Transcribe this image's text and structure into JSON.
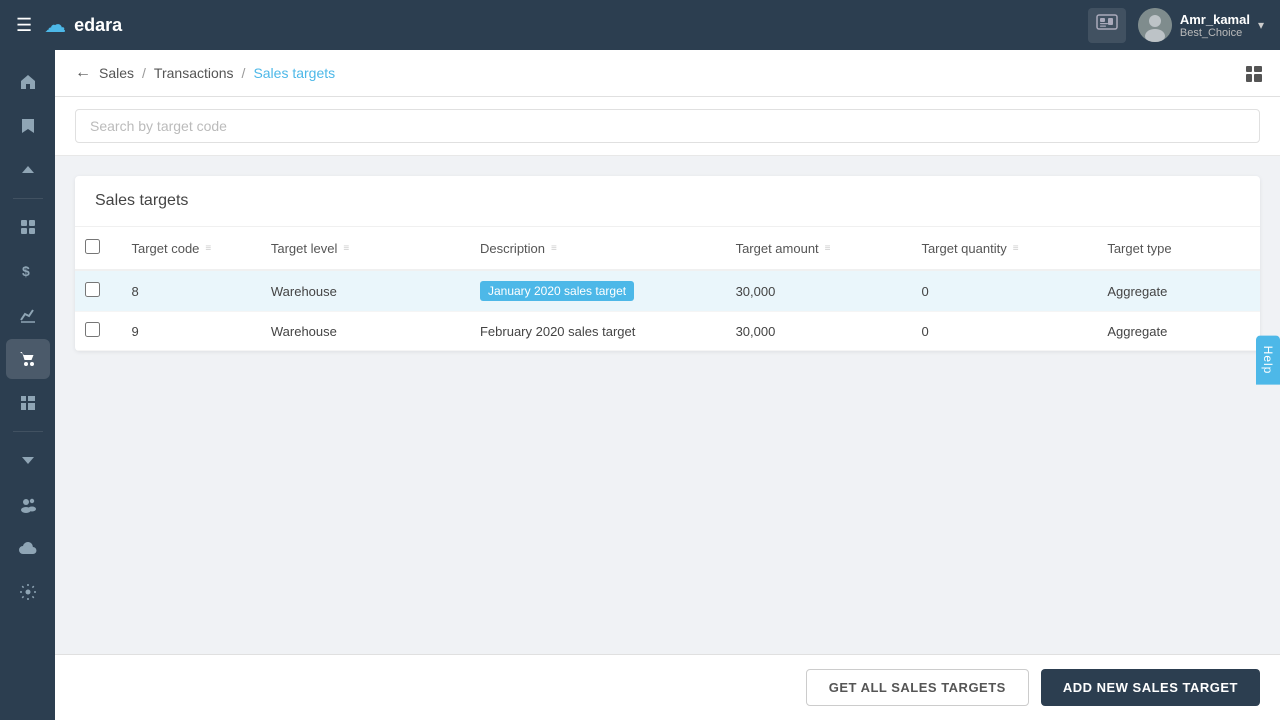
{
  "navbar": {
    "hamburger_label": "☰",
    "logo_text": "edara",
    "logo_cloud": "☁",
    "notification_icon": "🎫",
    "user_name": "Amr_kamal",
    "user_org": "Best_Choice",
    "chevron": "▾"
  },
  "sidebar": {
    "items": [
      {
        "id": "home",
        "icon": "⌂",
        "label": "Home"
      },
      {
        "id": "bookmark",
        "icon": "🔖",
        "label": "Bookmark"
      },
      {
        "id": "expand-up",
        "icon": "△",
        "label": "Expand Up"
      },
      {
        "id": "inventory",
        "icon": "▦",
        "label": "Inventory"
      },
      {
        "id": "dollar",
        "icon": "$",
        "label": "Finance"
      },
      {
        "id": "chart",
        "icon": "📈",
        "label": "Reports"
      },
      {
        "id": "cart",
        "icon": "🛒",
        "label": "Sales"
      },
      {
        "id": "grid",
        "icon": "⊞",
        "label": "Grid"
      },
      {
        "id": "expand-down",
        "icon": "▽",
        "label": "Expand Down"
      },
      {
        "id": "users",
        "icon": "👥",
        "label": "Users"
      },
      {
        "id": "cloud",
        "icon": "☁",
        "label": "Cloud"
      },
      {
        "id": "settings",
        "icon": "⚙",
        "label": "Settings"
      }
    ]
  },
  "breadcrumb": {
    "back_icon": "←",
    "items": [
      {
        "label": "Sales",
        "active": false
      },
      {
        "label": "Transactions",
        "active": false
      },
      {
        "label": "Sales targets",
        "active": true
      }
    ],
    "separators": [
      "/",
      "/"
    ]
  },
  "search": {
    "placeholder": "Search by target code",
    "value": ""
  },
  "table": {
    "title": "Sales targets",
    "columns": [
      {
        "key": "checkbox",
        "label": ""
      },
      {
        "key": "target_code",
        "label": "Target code"
      },
      {
        "key": "target_level",
        "label": "Target level"
      },
      {
        "key": "description",
        "label": "Description"
      },
      {
        "key": "target_amount",
        "label": "Target amount"
      },
      {
        "key": "target_quantity",
        "label": "Target quantity"
      },
      {
        "key": "target_type",
        "label": "Target type"
      }
    ],
    "rows": [
      {
        "id": 1,
        "target_code": "8",
        "target_level": "Warehouse",
        "description": "January 2020 sales target",
        "target_amount": "30,000",
        "target_quantity": "0",
        "target_type": "Aggregate",
        "highlighted": true
      },
      {
        "id": 2,
        "target_code": "9",
        "target_level": "Warehouse",
        "description": "February 2020 sales target",
        "target_amount": "30,000",
        "target_quantity": "0",
        "target_type": "Aggregate",
        "highlighted": false
      }
    ]
  },
  "footer": {
    "btn_secondary_label": "GET ALL SALES TARGETS",
    "btn_primary_label": "ADD NEW SALES TARGET"
  },
  "help_tab": "Help",
  "grid_icon": "⊞"
}
